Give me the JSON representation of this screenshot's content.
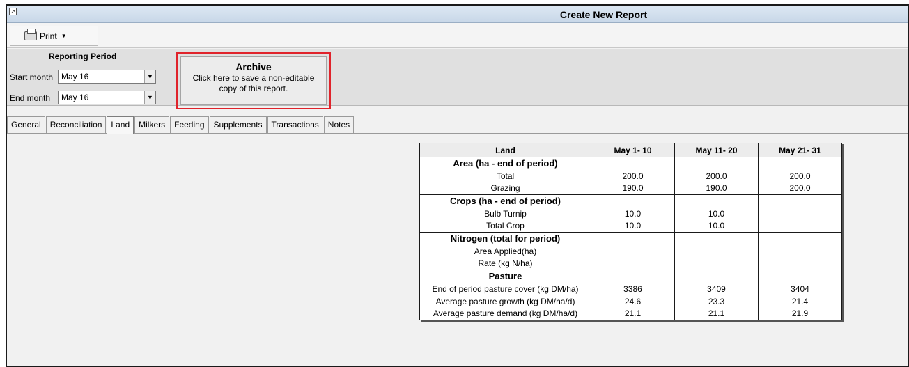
{
  "window": {
    "title": "Create New Report"
  },
  "toolbar": {
    "print_label": "Print"
  },
  "period": {
    "title": "Reporting Period",
    "start_label": "Start month",
    "start_value": "May 16",
    "end_label": "End month",
    "end_value": "May 16"
  },
  "archive": {
    "title": "Archive",
    "desc_line1": "Click here to save a non-editable",
    "desc_line2": "copy of this report."
  },
  "tabs": [
    "General",
    "Reconciliation",
    "Land",
    "Milkers",
    "Feeding",
    "Supplements",
    "Transactions",
    "Notes"
  ],
  "active_tab": "Land",
  "table": {
    "headers": [
      "Land",
      "May 1- 10",
      "May 11- 20",
      "May 21- 31"
    ],
    "rows": [
      {
        "label": "Area (ha - end of period)",
        "section": true,
        "values": [
          "",
          "",
          ""
        ]
      },
      {
        "label": "Total",
        "values": [
          "200.0",
          "200.0",
          "200.0"
        ]
      },
      {
        "label": "Grazing",
        "values": [
          "190.0",
          "190.0",
          "200.0"
        ]
      },
      {
        "label": "Crops (ha - end of period)",
        "section": true,
        "values": [
          "",
          "",
          ""
        ]
      },
      {
        "label": "Bulb Turnip",
        "values": [
          "10.0",
          "10.0",
          ""
        ]
      },
      {
        "label": "Total Crop",
        "values": [
          "10.0",
          "10.0",
          ""
        ]
      },
      {
        "label": "Nitrogen (total for period)",
        "section": true,
        "values": [
          "",
          "",
          ""
        ]
      },
      {
        "label": "Area Applied(ha)",
        "values": [
          "",
          "",
          ""
        ]
      },
      {
        "label": "Rate (kg N/ha)",
        "values": [
          "",
          "",
          ""
        ]
      },
      {
        "label": "Pasture",
        "section": true,
        "values": [
          "",
          "",
          ""
        ]
      },
      {
        "label": "End of period pasture cover (kg DM/ha)",
        "values": [
          "3386",
          "3409",
          "3404"
        ]
      },
      {
        "label": "Average pasture growth (kg DM/ha/d)",
        "values": [
          "24.6",
          "23.3",
          "21.4"
        ]
      },
      {
        "label": "Average pasture demand (kg DM/ha/d)",
        "values": [
          "21.1",
          "21.1",
          "21.9"
        ]
      }
    ]
  }
}
